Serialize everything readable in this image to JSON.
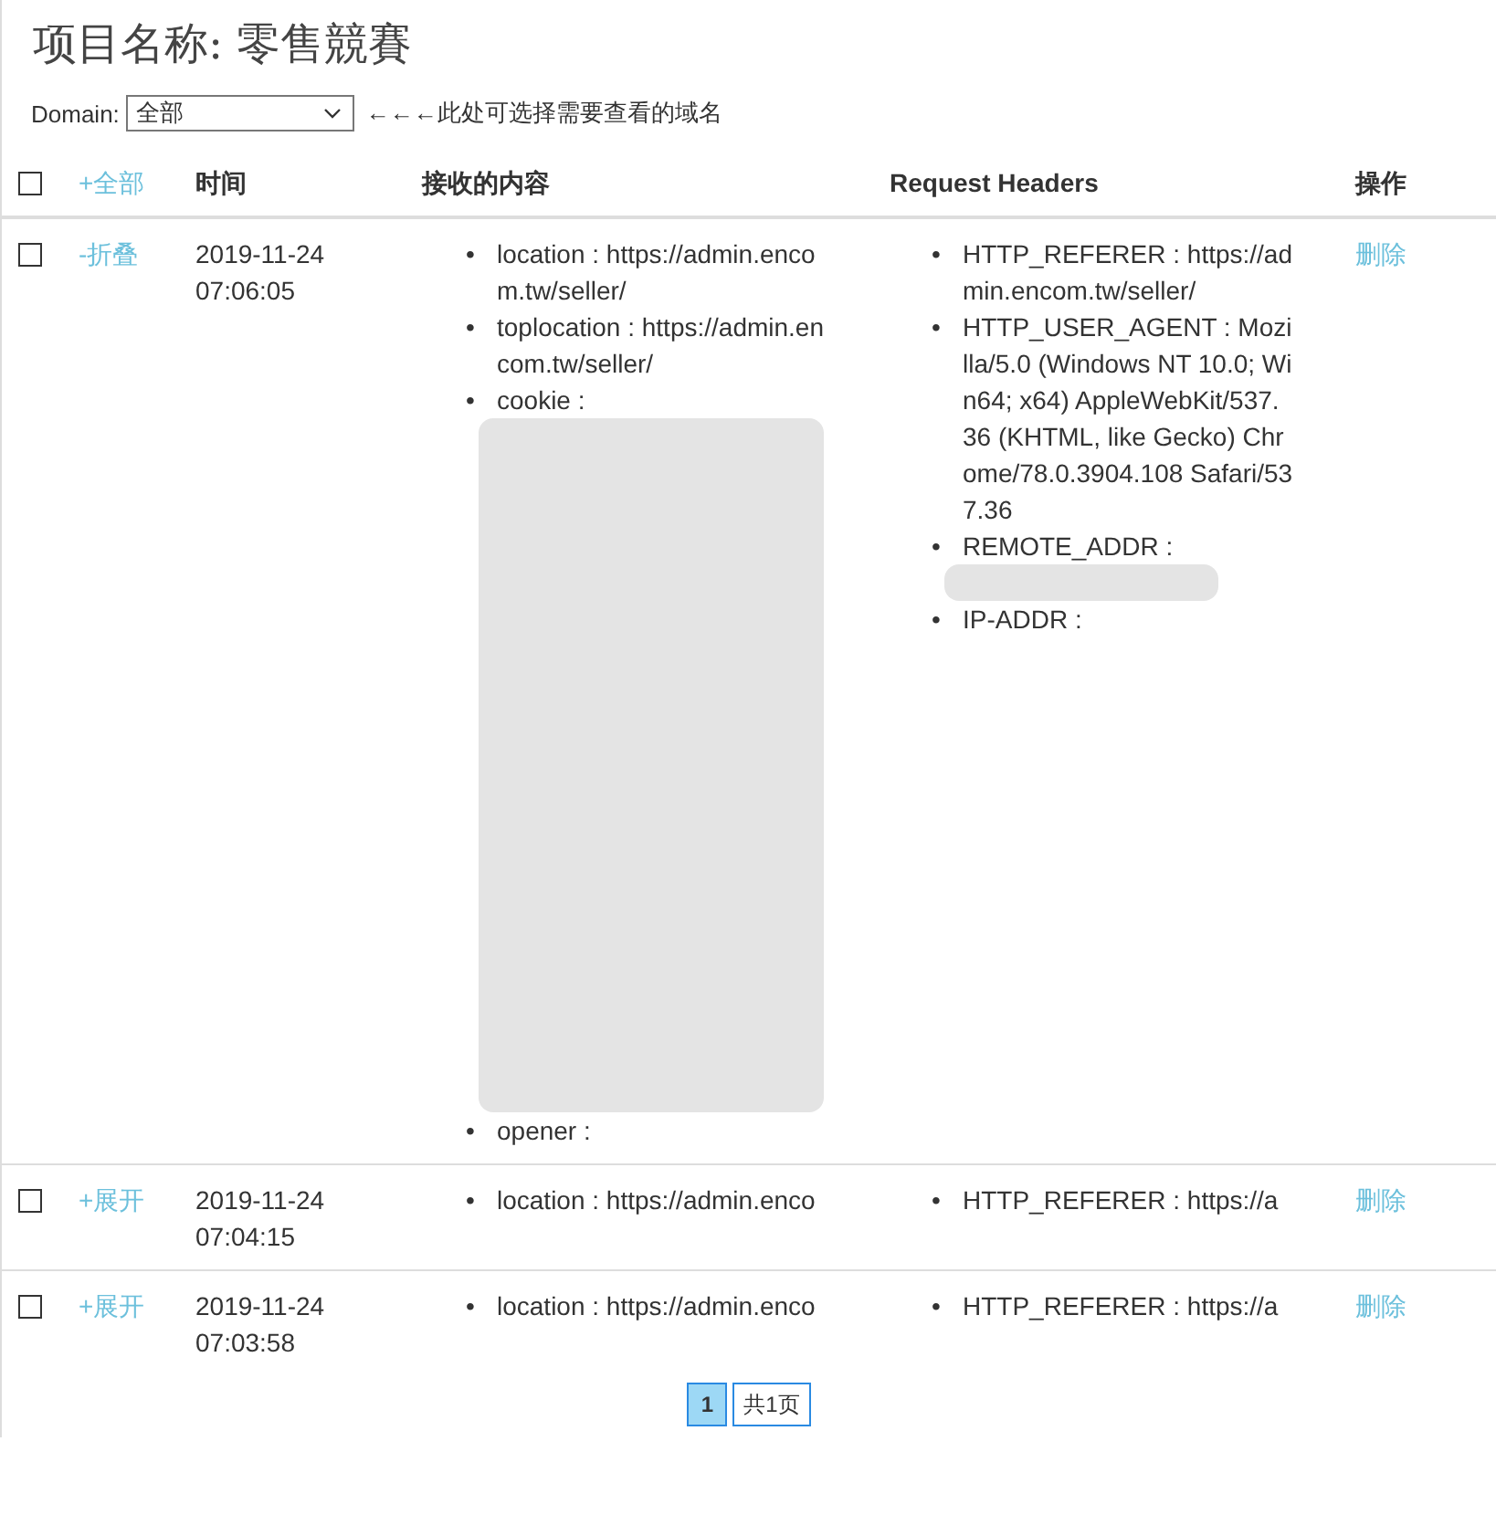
{
  "title": "项目名称: 零售競賽",
  "domain": {
    "label": "Domain:",
    "value": "全部",
    "hint": "←←←此处可选择需要查看的域名"
  },
  "table": {
    "header": {
      "checked": false,
      "toggle": "+全部",
      "columns": [
        "时间",
        "接收的内容",
        "Request Headers",
        "操作"
      ]
    },
    "rows": [
      {
        "checked": false,
        "toggle": "-折叠",
        "date": "2019-11-24",
        "time": "07:06:05",
        "content": [
          {
            "bullet": "•",
            "text": "location : https://admin.encom.tw/seller/",
            "kind": "plain"
          },
          {
            "bullet": "•",
            "text": "toplocation : https://admin.encom.tw/seller/",
            "kind": "plain"
          },
          {
            "bullet": "•",
            "text": "cookie :",
            "kind": "redacted-long"
          },
          {
            "bullet": "•",
            "text": "opener :",
            "kind": "plain"
          }
        ],
        "headers": [
          {
            "bullet": "•",
            "text": "HTTP_REFERER : https://admin.encom.tw/seller/",
            "kind": "plain"
          },
          {
            "bullet": "•",
            "text": "HTTP_USER_AGENT : Mozilla/5.0 (Windows NT 10.0; Win64; x64) AppleWebKit/537.36 (KHTML, like Gecko) Chrome/78.0.3904.108 Safari/537.36",
            "kind": "plain"
          },
          {
            "bullet": "•",
            "text": "REMOTE_ADDR :",
            "kind": "redacted-short"
          },
          {
            "bullet": "•",
            "text": "IP-ADDR :",
            "kind": "plain"
          }
        ],
        "action": "删除"
      },
      {
        "checked": false,
        "toggle": "+展开",
        "date": "2019-11-24",
        "time": "07:04:15",
        "content": [
          {
            "bullet": "•",
            "text": "location : https://admin.enco",
            "kind": "plain"
          }
        ],
        "headers": [
          {
            "bullet": "•",
            "text": "HTTP_REFERER : https://a",
            "kind": "plain"
          }
        ],
        "action": "删除"
      },
      {
        "checked": false,
        "toggle": "+展开",
        "date": "2019-11-24",
        "time": "07:03:58",
        "content": [
          {
            "bullet": "•",
            "text": "location : https://admin.enco",
            "kind": "plain"
          }
        ],
        "headers": [
          {
            "bullet": "•",
            "text": "HTTP_REFERER : https://a",
            "kind": "plain"
          }
        ],
        "action": "删除"
      }
    ]
  },
  "pagination": [
    {
      "label": "1",
      "selected": true
    },
    {
      "label": "共1页",
      "selected": false
    }
  ]
}
